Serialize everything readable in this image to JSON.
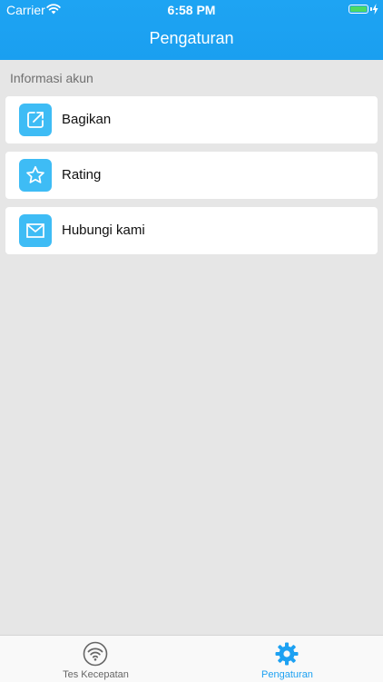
{
  "status_bar": {
    "carrier": "Carrier",
    "time": "6:58 PM",
    "battery_level": 1.0
  },
  "header": {
    "title": "Pengaturan"
  },
  "section": {
    "label": "Informasi akun"
  },
  "menu": {
    "items": [
      {
        "label": "Bagikan",
        "icon": "share-icon"
      },
      {
        "label": "Rating",
        "icon": "star-icon"
      },
      {
        "label": "Hubungi kami",
        "icon": "mail-icon"
      }
    ]
  },
  "tabbar": {
    "tabs": [
      {
        "label": "Tes Kecepatan",
        "icon": "wifi-icon",
        "active": false
      },
      {
        "label": "Pengaturan",
        "icon": "gear-icon",
        "active": true
      }
    ]
  },
  "colors": {
    "header": "#1da1f2",
    "accent": "#1da1f2",
    "icon_tile": "#3ebcf5",
    "inactive_tab": "#666666",
    "background": "#e6e6e6"
  }
}
